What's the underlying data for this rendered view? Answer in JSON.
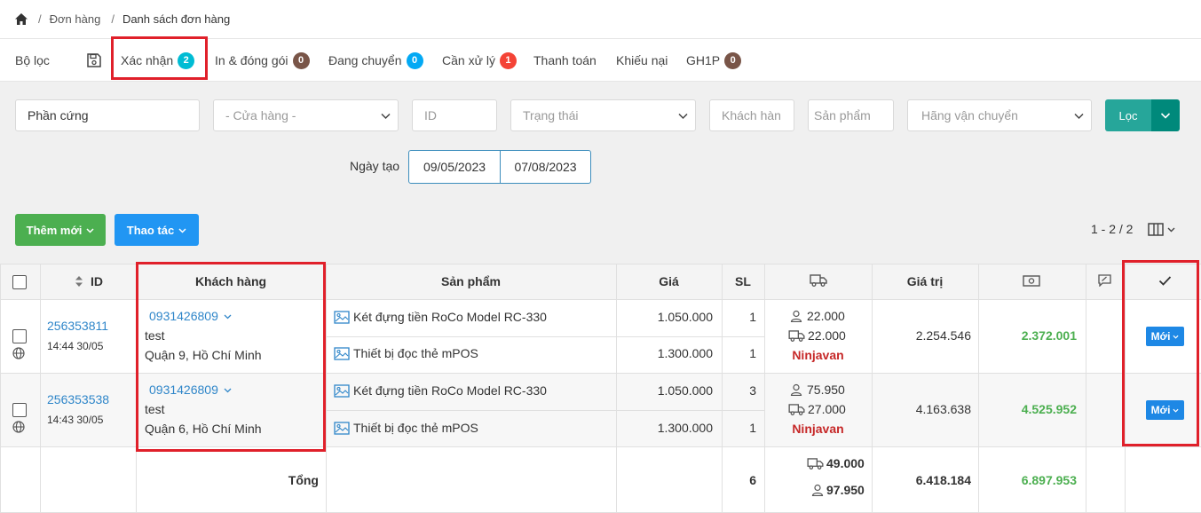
{
  "breadcrumb": {
    "level1": "Đơn hàng",
    "level2": "Danh sách đơn hàng",
    "separator": "/"
  },
  "tabs": {
    "filter": "Bộ lọc",
    "confirm": {
      "label": "Xác nhận",
      "count": "2"
    },
    "print": {
      "label": "In & đóng gói",
      "count": "0"
    },
    "shipping": {
      "label": "Đang chuyển",
      "count": "0"
    },
    "handle": {
      "label": "Cần xử lý",
      "count": "1"
    },
    "payment": "Thanh toán",
    "complaint": "Khiếu nại",
    "gh1p": {
      "label": "GH1P",
      "count": "0"
    }
  },
  "filters": {
    "category": "Phần cứng",
    "store": "- Cửa hàng -",
    "id": "ID",
    "status": "Trạng thái",
    "customer": "Khách hàn",
    "product": "Sản phẩm",
    "carrier": "Hãng vận chuyển",
    "filter_button": "Lọc",
    "created_label": "Ngày tạo",
    "date_from": "09/05/2023",
    "date_to": "07/08/2023"
  },
  "actions": {
    "add_new": "Thêm mới",
    "operations": "Thao tác",
    "pagination": "1 - 2 / 2"
  },
  "table": {
    "headers": {
      "id": "ID",
      "customer": "Khách hàng",
      "product": "Sản phẩm",
      "price": "Giá",
      "qty": "SL",
      "value": "Giá trị"
    },
    "orders": [
      {
        "id": "256353811",
        "time": "14:44 30/05",
        "phone": "0931426809",
        "name": "test",
        "address": "Quận 9, Hồ Chí Minh",
        "items": [
          {
            "name": "Két đựng tiền RoCo Model RC-330",
            "price": "1.050.000",
            "qty": "1"
          },
          {
            "name": "Thiết bị đọc thẻ mPOS",
            "price": "1.300.000",
            "qty": "1"
          }
        ],
        "fee_customer": "22.000",
        "fee_ship": "22.000",
        "carrier": "Ninjavan",
        "value": "2.254.546",
        "total": "2.372.001",
        "status": "Mới"
      },
      {
        "id": "256353538",
        "time": "14:43 30/05",
        "phone": "0931426809",
        "name": "test",
        "address": "Quận 6, Hồ Chí Minh",
        "items": [
          {
            "name": "Két đựng tiền RoCo Model RC-330",
            "price": "1.050.000",
            "qty": "3"
          },
          {
            "name": "Thiết bị đọc thẻ mPOS",
            "price": "1.300.000",
            "qty": "1"
          }
        ],
        "fee_customer": "75.950",
        "fee_ship": "27.000",
        "carrier": "Ninjavan",
        "value": "4.163.638",
        "total": "4.525.952",
        "status": "Mới"
      }
    ],
    "footer": {
      "label": "Tổng",
      "qty": "6",
      "ship": "49.000",
      "customer": "97.950",
      "value": "6.418.184",
      "total": "6.897.953"
    }
  },
  "colors": {
    "teal": "#26a69a",
    "teal_dark": "#00897b",
    "green": "#4caf50",
    "blue": "#2196f3",
    "badge_red": "#f44336",
    "badge_brown": "#795548",
    "badge_cyan": "#00bcd4",
    "badge_blue": "#03a9f4",
    "highlight": "#e0202a"
  }
}
